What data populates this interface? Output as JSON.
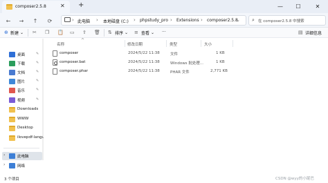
{
  "window": {
    "tab_title": "composer2.5.8",
    "new_tab_glyph": "+",
    "tab_close_glyph": "✕",
    "minimize_glyph": "—",
    "maximize_glyph": "☐",
    "close_glyph": "✕"
  },
  "nav_buttons": {
    "back": "←",
    "forward": "→",
    "up": "↑",
    "refresh": "⟳"
  },
  "breadcrumbs": [
    "此电脑",
    "本地磁盘 (C:)",
    "phpstudy_pro",
    "Extensions",
    "composer2.5.8"
  ],
  "breadcrumb_separator": "›",
  "search": {
    "placeholder": "在 composer2.5.8 中搜索"
  },
  "commands": {
    "new": "新建",
    "sort": "排序",
    "view": "查看",
    "more": "···",
    "details_pane": "详细信息"
  },
  "sidebar": {
    "items": [
      {
        "label": "桌面",
        "icon": "desktop-icon",
        "color": "#2f6fd6",
        "pinned": true
      },
      {
        "label": "下载",
        "icon": "download-icon",
        "color": "#2a9d5c",
        "pinned": true
      },
      {
        "label": "文档",
        "icon": "documents-icon",
        "color": "#4a7bd0",
        "pinned": true
      },
      {
        "label": "图片",
        "icon": "pictures-icon",
        "color": "#3f88d8",
        "pinned": true
      },
      {
        "label": "音乐",
        "icon": "music-icon",
        "color": "#e0574f",
        "pinned": true
      },
      {
        "label": "视频",
        "icon": "videos-icon",
        "color": "#7a5bd6",
        "pinned": true
      },
      {
        "label": "Downloads",
        "icon": "folder-icon",
        "color": "#f1c14f",
        "pinned": false
      },
      {
        "label": "WWW",
        "icon": "folder-icon",
        "color": "#f1c14f",
        "pinned": false
      },
      {
        "label": "Desktop",
        "icon": "folder-icon",
        "color": "#f1c14f",
        "pinned": false
      },
      {
        "label": "ilovepdf-langu",
        "icon": "folder-icon",
        "color": "#f1c14f",
        "pinned": false
      },
      {
        "label": "此电脑",
        "icon": "this-pc-icon",
        "color": "#3d7fd6",
        "selected": true
      },
      {
        "label": "网络",
        "icon": "network-icon",
        "color": "#3d7fd6"
      }
    ],
    "pin_glyph": "📌",
    "chevron": "›"
  },
  "columns": [
    "名称",
    "修改日期",
    "类型",
    "大小"
  ],
  "files": [
    {
      "name": "composer",
      "date": "2024/5/22 11:38",
      "type": "文件",
      "size": "1 KB",
      "icon": "file-icon"
    },
    {
      "name": "composer.bat",
      "date": "2024/5/22 11:38",
      "type": "Windows 批处理...",
      "size": "1 KB",
      "icon": "batch-file-icon"
    },
    {
      "name": "composer.phar",
      "date": "2024/5/22 11:38",
      "type": "PHAR 文件",
      "size": "2,771 KB",
      "icon": "file-icon"
    }
  ],
  "status": {
    "item_count": "3 个项目",
    "watermark": "CSDN @wyy的小尾巴"
  }
}
